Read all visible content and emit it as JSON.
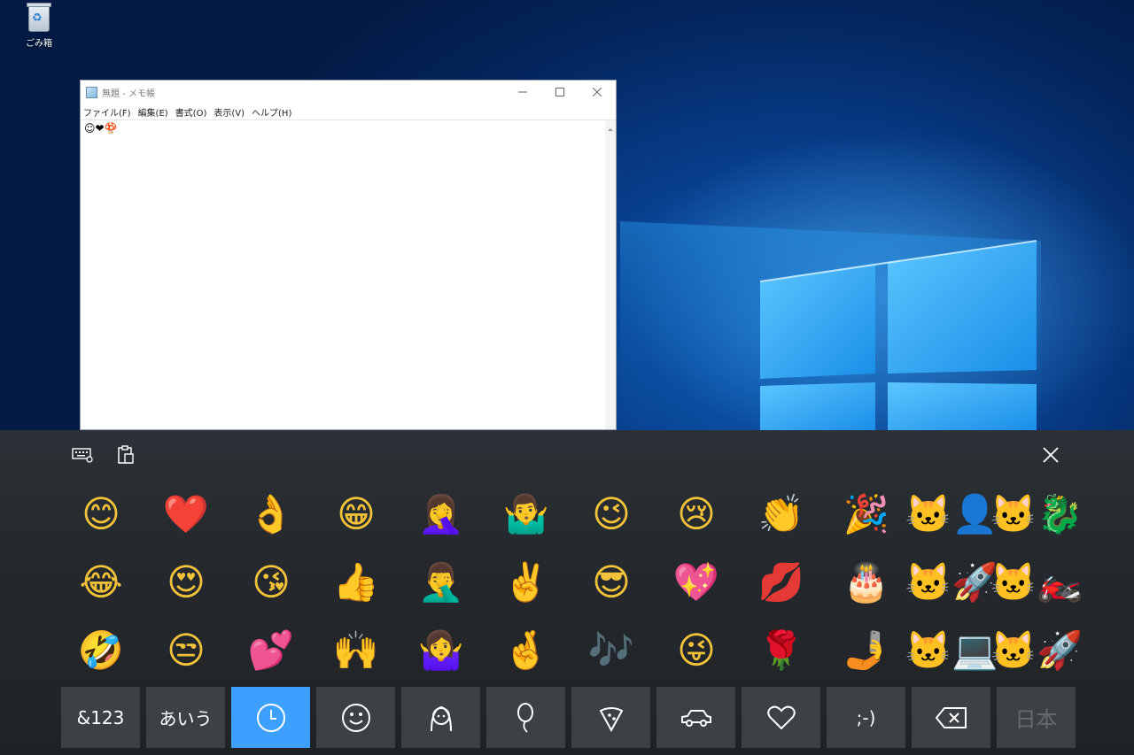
{
  "desktop": {
    "recycle_bin_label": "ごみ箱"
  },
  "notepad": {
    "title": "無題 - メモ帳",
    "menu": [
      "ファイル(F)",
      "編集(E)",
      "書式(O)",
      "表示(V)",
      "ヘルプ(H)"
    ],
    "content": "☺❤🍄"
  },
  "emoji_panel": {
    "active_category": "recent",
    "emojis": [
      "😊",
      "❤️",
      "👌",
      "😁",
      "🤦‍♀️",
      "🤷‍♂️",
      "😉",
      "😢",
      "👏",
      "🎉",
      "🐱‍👤",
      "🐱‍🐉",
      "😂",
      "😍",
      "😘",
      "👍",
      "🤦‍♂️",
      "✌️",
      "😎",
      "💖",
      "💋",
      "🎂",
      "🐱‍🚀",
      "🐱‍🏍",
      "🤣",
      "😒",
      "💕",
      "🙌",
      "🤷‍♀️",
      "🤞",
      "🎶",
      "😜",
      "🌹",
      "🤳",
      "🐱‍💻",
      "🐱‍🚀"
    ],
    "bottom_keys": [
      {
        "name": "symbols-key",
        "label": "&123"
      },
      {
        "name": "hiragana-key",
        "label": "あいう"
      },
      {
        "name": "recent-tab",
        "label": "",
        "icon": "clock-icon"
      },
      {
        "name": "smiley-tab",
        "label": "",
        "icon": "smiley-icon"
      },
      {
        "name": "people-tab",
        "label": "",
        "icon": "person-icon"
      },
      {
        "name": "celebration-tab",
        "label": "",
        "icon": "balloon-icon"
      },
      {
        "name": "food-tab",
        "label": "",
        "icon": "pizza-icon"
      },
      {
        "name": "transport-tab",
        "label": "",
        "icon": "car-icon"
      },
      {
        "name": "heart-tab",
        "label": "",
        "icon": "heart-icon"
      },
      {
        "name": "emoticon-tab",
        "label": ";-)"
      },
      {
        "name": "backspace-key",
        "label": "",
        "icon": "backspace-icon"
      },
      {
        "name": "language-key",
        "label": "日本"
      }
    ],
    "accent_color": "#3da0ff"
  }
}
